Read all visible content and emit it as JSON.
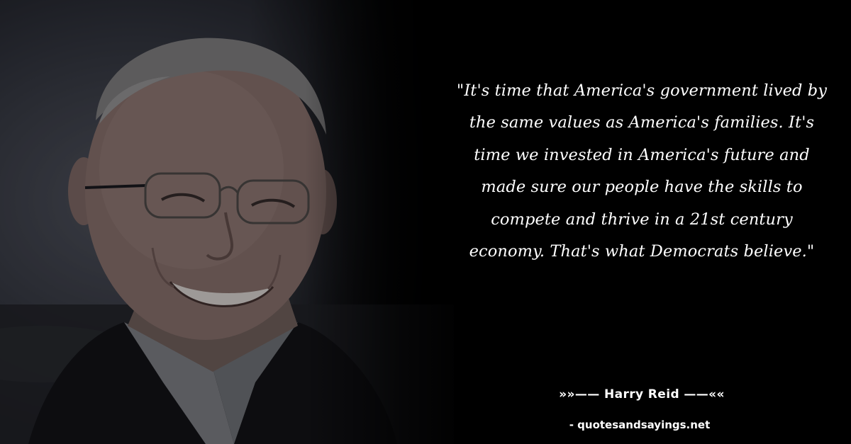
{
  "quote": {
    "text": "\"It's time that America's government lived by the same values as America's families. It's time we invested in America's future and made sure our people have the skills to compete and thrive in a 21st century economy. That's what Democrats believe.\""
  },
  "author": {
    "line": "»»——  Harry Reid  ——««"
  },
  "source": {
    "site": "- quotesandsayings.net"
  },
  "colors": {
    "background": "#000000",
    "text": "#ffffff"
  }
}
